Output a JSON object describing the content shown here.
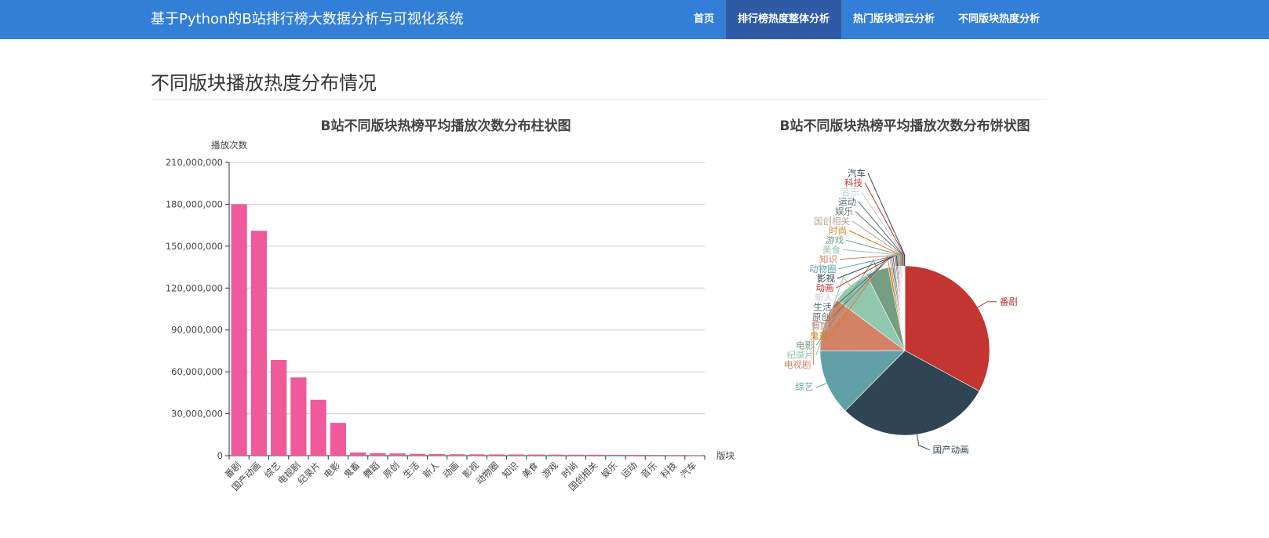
{
  "navbar": {
    "brand": "基于Python的B站排行榜大数据分析与可视化系统",
    "items": [
      {
        "label": "首页",
        "active": false
      },
      {
        "label": "排行榜热度整体分析",
        "active": true
      },
      {
        "label": "热门版块词云分析",
        "active": false
      },
      {
        "label": "不同版块热度分析",
        "active": false
      }
    ],
    "bg_color": "#337fd8",
    "active_color": "#2f5aa6"
  },
  "page": {
    "title": "不同版块播放热度分布情况"
  },
  "chart_data": [
    {
      "type": "bar",
      "title": "B站不同版块热榜平均播放次数分布柱状图",
      "xlabel": "版块",
      "ylabel": "播放次数",
      "ylim": [
        0,
        210000000
      ],
      "yticks": [
        0,
        30000000,
        60000000,
        90000000,
        120000000,
        150000000,
        180000000,
        210000000
      ],
      "ytick_labels": [
        "0",
        "30,000,000",
        "60,000,000",
        "90,000,000",
        "120,000,000",
        "150,000,000",
        "180,000,000",
        "210,000,000"
      ],
      "grid": true,
      "bar_color": "#ee5a9a",
      "categories": [
        "番剧",
        "国产动画",
        "综艺",
        "电视剧",
        "纪录片",
        "电影",
        "鬼畜",
        "舞蹈",
        "原创",
        "生活",
        "新人",
        "动画",
        "影视",
        "动物圈",
        "知识",
        "美食",
        "游戏",
        "时尚",
        "国创相关",
        "娱乐",
        "运动",
        "音乐",
        "科技",
        "汽车"
      ],
      "values": [
        180000000,
        161000000,
        68500000,
        56000000,
        40000000,
        23500000,
        2300000,
        1800000,
        1600000,
        1300000,
        1100000,
        1000000,
        950000,
        900000,
        850000,
        800000,
        750000,
        700000,
        650000,
        600000,
        550000,
        500000,
        450000,
        400000
      ]
    },
    {
      "type": "pie",
      "title": "B站不同版块热榜平均播放次数分布饼状图",
      "colors": [
        "#c23531",
        "#2f4554",
        "#61a0a8",
        "#d48265",
        "#91c7ae",
        "#749f83",
        "#ca8622",
        "#bda29a",
        "#6e7074",
        "#546570",
        "#c4ccd3"
      ],
      "labels": [
        "番剧",
        "国产动画",
        "综艺",
        "电视剧",
        "纪录片",
        "电影",
        "鬼畜",
        "舞蹈",
        "原创",
        "生活",
        "新人",
        "动画",
        "影视",
        "动物圈",
        "知识",
        "美食",
        "游戏",
        "时尚",
        "国创相关",
        "娱乐",
        "运动",
        "音乐",
        "科技",
        "汽车"
      ],
      "values": [
        180000000,
        161000000,
        68500000,
        56000000,
        40000000,
        23500000,
        2300000,
        1800000,
        1600000,
        1300000,
        1100000,
        1000000,
        950000,
        900000,
        850000,
        800000,
        750000,
        700000,
        650000,
        600000,
        550000,
        500000,
        450000,
        400000
      ]
    }
  ]
}
